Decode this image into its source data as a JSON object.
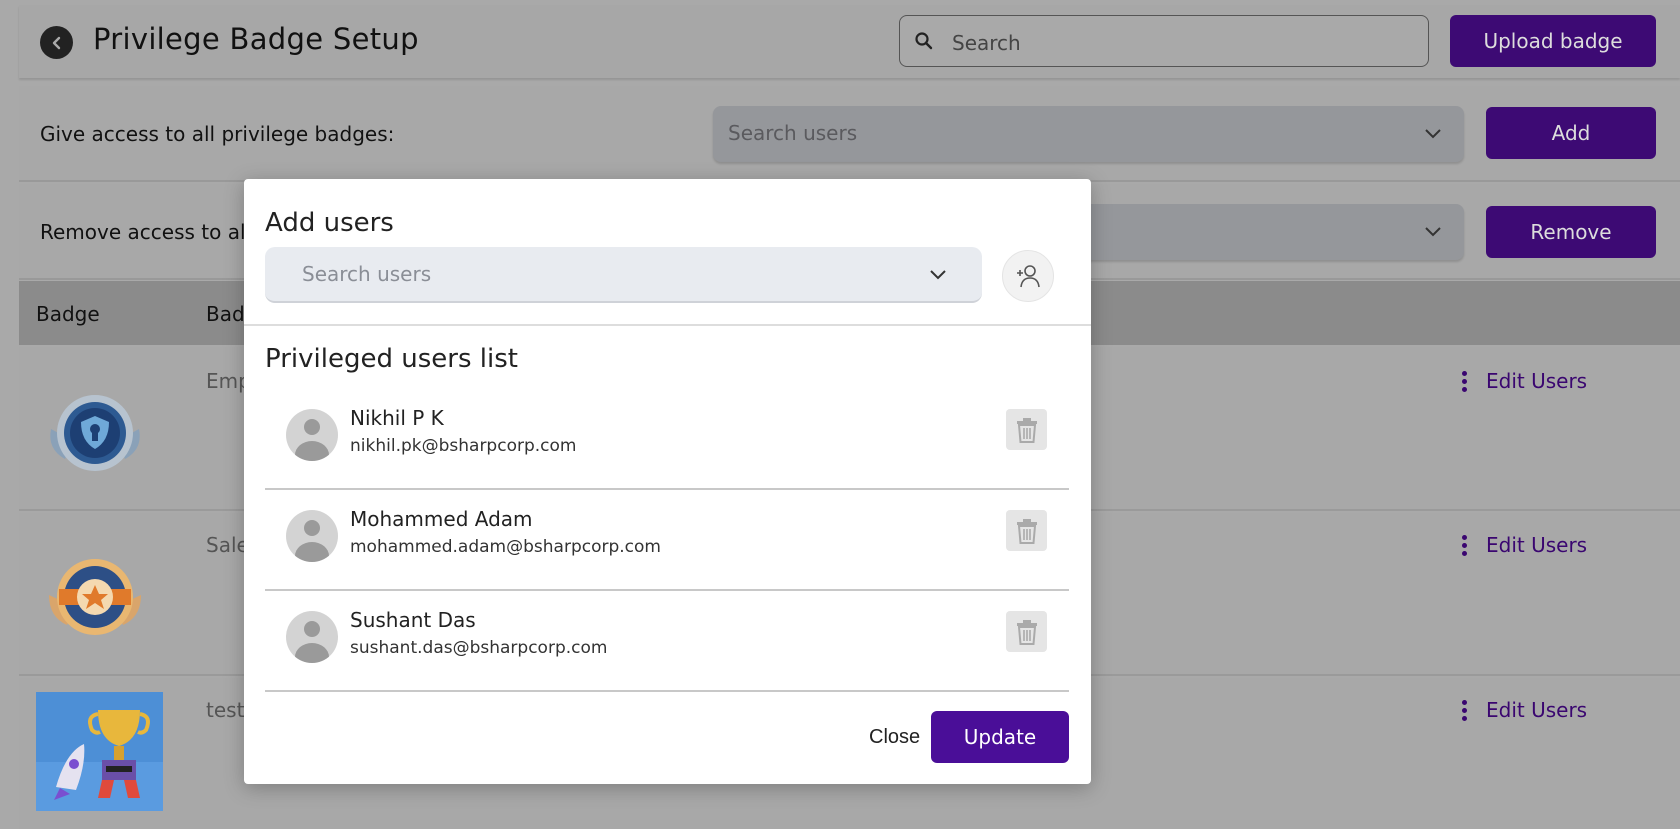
{
  "header": {
    "title": "Privilege Badge Setup",
    "search_placeholder": "Search",
    "upload_label": "Upload badge"
  },
  "give_access": {
    "label": "Give access to all privilege badges:",
    "placeholder": "Search users",
    "button": "Add"
  },
  "remove_access": {
    "label": "Remove access to all",
    "button": "Remove"
  },
  "table": {
    "headers": [
      "Badge",
      "Bad"
    ],
    "rows": [
      {
        "name": "Emp",
        "action": "Edit Users"
      },
      {
        "name": "Sale",
        "action": "Edit Users"
      },
      {
        "name": "test",
        "action": "Edit Users"
      }
    ]
  },
  "modal": {
    "title": "Add users",
    "search_placeholder": "Search users",
    "list_title": "Privileged users list",
    "users": [
      {
        "name": "Nikhil P K",
        "email": "nikhil.pk@bsharpcorp.com"
      },
      {
        "name": "Mohammed Adam",
        "email": "mohammed.adam@bsharpcorp.com"
      },
      {
        "name": "Sushant Das",
        "email": "sushant.das@bsharpcorp.com"
      }
    ],
    "close_label": "Close",
    "update_label": "Update"
  },
  "colors": {
    "accent": "#4a0e98",
    "overlay": "#a8a8a8"
  }
}
